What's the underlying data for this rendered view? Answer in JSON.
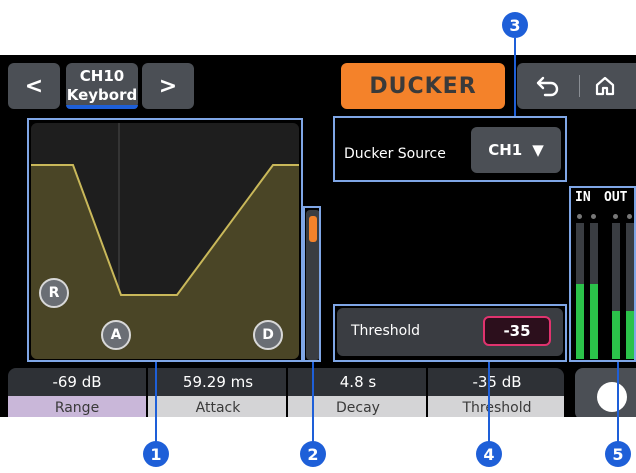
{
  "header": {
    "prev_label": "<",
    "channel_number": "CH10",
    "channel_name": "Keybord",
    "next_label": ">",
    "title": "DUCKER",
    "back_icon": "undo-arrow-icon",
    "home_icon": "home-icon"
  },
  "graph": {
    "handles": {
      "range": "R",
      "attack": "A",
      "decay": "D"
    }
  },
  "ducker_source": {
    "label": "Ducker Source",
    "value": "CH1"
  },
  "threshold_panel": {
    "label": "Threshold",
    "value": "-35"
  },
  "meters": {
    "in_label": "IN",
    "out_label": "OUT",
    "in_levels": [
      0.55,
      0.55
    ],
    "out_levels": [
      0.35,
      0.35
    ],
    "color": "#2bc24a"
  },
  "params": [
    {
      "value": "-69 dB",
      "label": "Range",
      "selected": true
    },
    {
      "value": "59.29 ms",
      "label": "Attack",
      "selected": false
    },
    {
      "value": "4.8 s",
      "label": "Decay",
      "selected": false
    },
    {
      "value": "-35 dB",
      "label": "Threshold",
      "selected": false
    }
  ],
  "callouts": [
    "1",
    "2",
    "3",
    "4",
    "5"
  ],
  "colors": {
    "accent": "#f4822a",
    "callout": "#1e5fd8",
    "threshold_border": "#e0336e",
    "curve": "#c9b85a",
    "curve_fill": "#4a4526"
  }
}
